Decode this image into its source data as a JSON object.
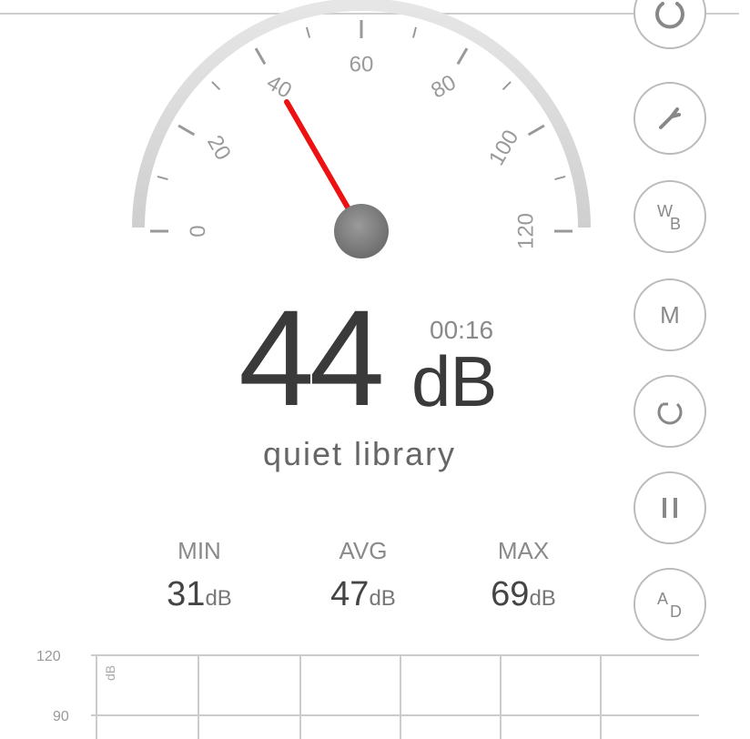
{
  "gauge": {
    "ticks": [
      "0",
      "20",
      "40",
      "60",
      "80",
      "100",
      "120"
    ],
    "needle_value": 40
  },
  "reading": {
    "value": "44",
    "unit": "dB",
    "timer": "00:16",
    "description": "quiet library"
  },
  "stats": [
    {
      "name": "MIN",
      "value": "31",
      "unit": "dB"
    },
    {
      "name": "AVG",
      "value": "47",
      "unit": "dB"
    },
    {
      "name": "MAX",
      "value": "69",
      "unit": "dB"
    }
  ],
  "toolbar": {
    "buttons": [
      {
        "name": "power-button",
        "icon": "power-icon"
      },
      {
        "name": "settings-button",
        "icon": "wrench-icon"
      },
      {
        "name": "weighting-button",
        "icon": "weighting-icon",
        "text_a": "W",
        "text_b": "B"
      },
      {
        "name": "mode-button",
        "icon": "m-icon",
        "text": "M"
      },
      {
        "name": "reset-button",
        "icon": "reset-icon"
      },
      {
        "name": "pause-button",
        "icon": "pause-icon"
      },
      {
        "name": "response-button",
        "icon": "response-icon",
        "text_a": "A",
        "text_b": "D"
      }
    ]
  },
  "history_chart": {
    "y_ticks": [
      "120",
      "90"
    ],
    "series_label": "dB"
  }
}
